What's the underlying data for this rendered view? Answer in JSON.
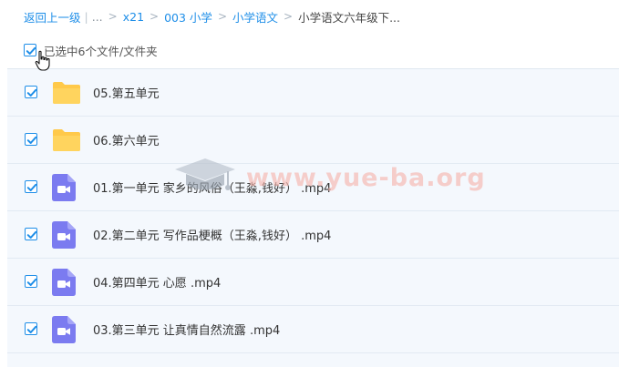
{
  "breadcrumb": {
    "back": "返回上一级",
    "ellipsis": "...",
    "items": [
      "x21",
      "003 小学",
      "小学语文"
    ],
    "current": "小学语文六年级下..."
  },
  "selection": {
    "label": "已选中6个文件/文件夹"
  },
  "files": [
    {
      "name": "05.第五单元",
      "type": "folder-icon"
    },
    {
      "name": "06.第六单元",
      "type": "folder-icon"
    },
    {
      "name": "01.第一单元 家乡的风俗（王淼,钱好） .mp4",
      "type": "video-file-icon"
    },
    {
      "name": "02.第二单元 写作品梗概（王淼,钱好） .mp4",
      "type": "video-file-icon"
    },
    {
      "name": "04.第四单元 心愿 .mp4",
      "type": "video-file-icon"
    },
    {
      "name": "03.第三单元 让真情自然流露 .mp4",
      "type": "video-file-icon"
    }
  ],
  "watermark": "www.yue-ba.org",
  "colors": {
    "accent": "#1e8ee8",
    "folder": "#ffc94a",
    "video": "#7b7bf0",
    "list_bg": "#f4f8fd"
  }
}
